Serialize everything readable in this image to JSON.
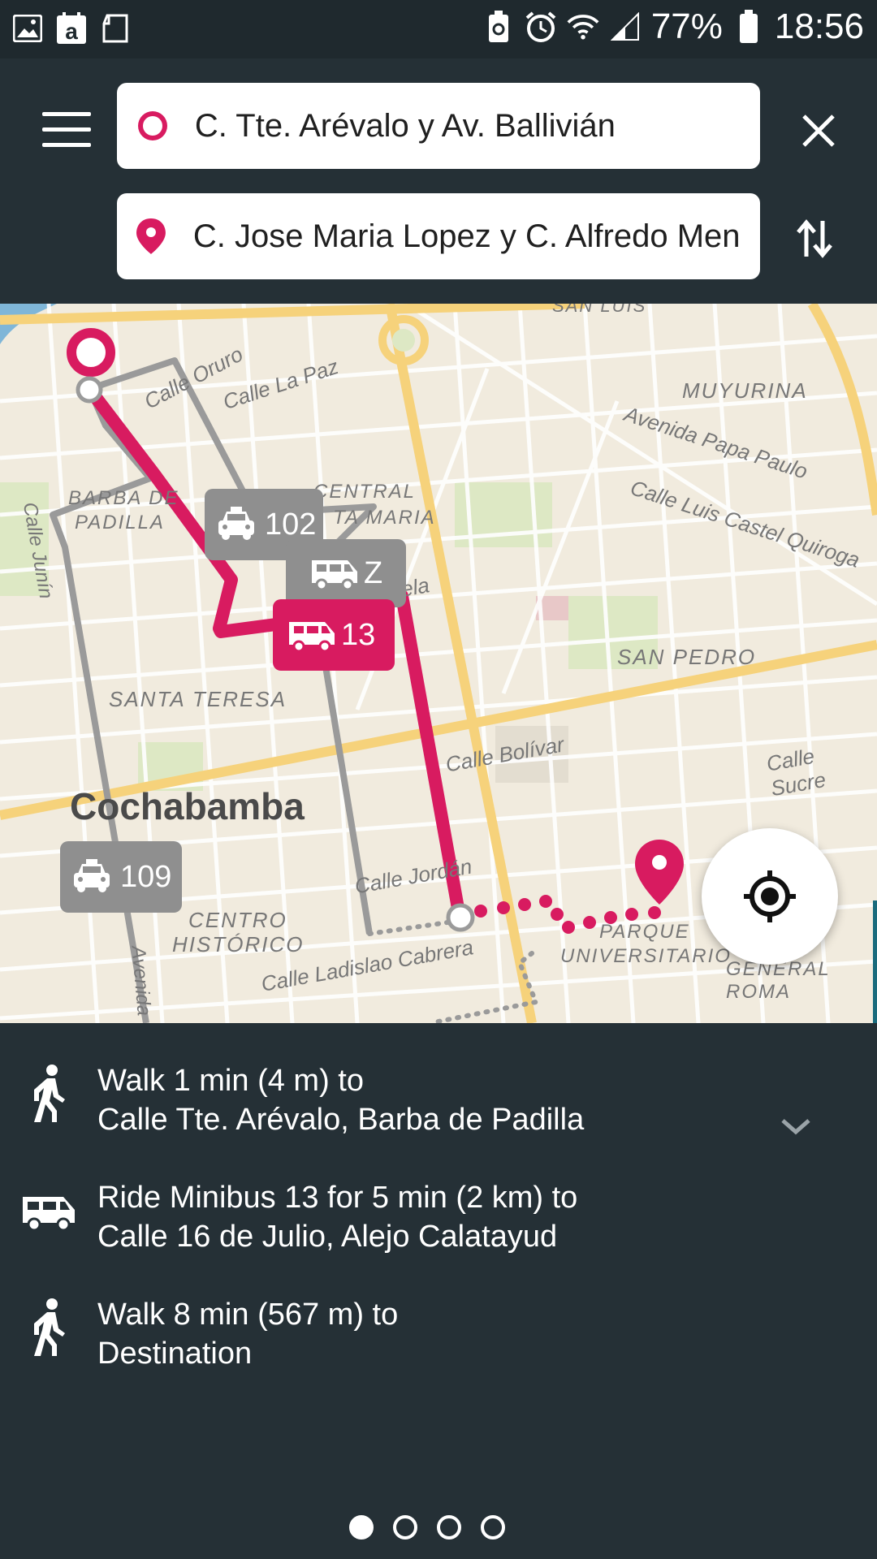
{
  "status_bar": {
    "battery_percent": "77%",
    "time": "18:56",
    "left_icons": [
      "gallery-icon",
      "amazon-icon",
      "sd-card-icon"
    ],
    "right_icons": [
      "recycle-battery-icon",
      "alarm-icon",
      "wifi-icon",
      "signal-icon",
      "battery-icon"
    ]
  },
  "search": {
    "origin": "C. Tte. Arévalo y Av. Ballivián",
    "destination": "C. Jose Maria Lopez y C. Alfredo Men"
  },
  "colors": {
    "accent": "#d81b60",
    "header_bg": "#253036",
    "map_bg": "#f1ebde",
    "route_gray": "#9a9a9a",
    "main_road": "#f6d27b"
  },
  "map": {
    "city_label": "Cochabamba",
    "district_labels": [
      "SAN LUIS",
      "MUYURINA",
      "BARBA DE",
      "PADILLA",
      "CENTRAL",
      "TA MARIA",
      "SAN PEDRO",
      "SANTA TERESA",
      "CENTRO",
      "HISTÓRICO",
      "PARQUE",
      "UNIVERSITARIO",
      "GENERAL ROMA"
    ],
    "street_labels": [
      "Calle Oruro",
      "Calle La Paz",
      "Avenida Papa Paulo",
      "Calle Luis Castel Quiroga",
      "Calle Junín",
      "Calle Bolívar",
      "Calle Sucre",
      "Calle Jordán",
      "Calle Ladislao Cabrera",
      "Avenida",
      "ela"
    ],
    "badges": [
      {
        "icon": "taxi-icon",
        "label": "102",
        "style": "gray"
      },
      {
        "icon": "minibus-icon",
        "label": "Z",
        "style": "gray"
      },
      {
        "icon": "minibus-icon",
        "label": "13",
        "style": "pink"
      },
      {
        "icon": "taxi-icon",
        "label": "109",
        "style": "gray"
      }
    ]
  },
  "steps": [
    {
      "icon": "walk-icon",
      "line1": "Walk 1 min (4 m) to",
      "line2": "Calle Tte. Arévalo, Barba de Padilla"
    },
    {
      "icon": "minibus-icon",
      "line1": "Ride Minibus 13 for 5 min (2 km) to",
      "line2": "Calle 16 de Julio, Alejo Calatayud"
    },
    {
      "icon": "walk-icon",
      "line1": "Walk 8 min (567 m) to",
      "line2": "Destination"
    }
  ],
  "pager": {
    "pages": 4,
    "active": 1
  }
}
